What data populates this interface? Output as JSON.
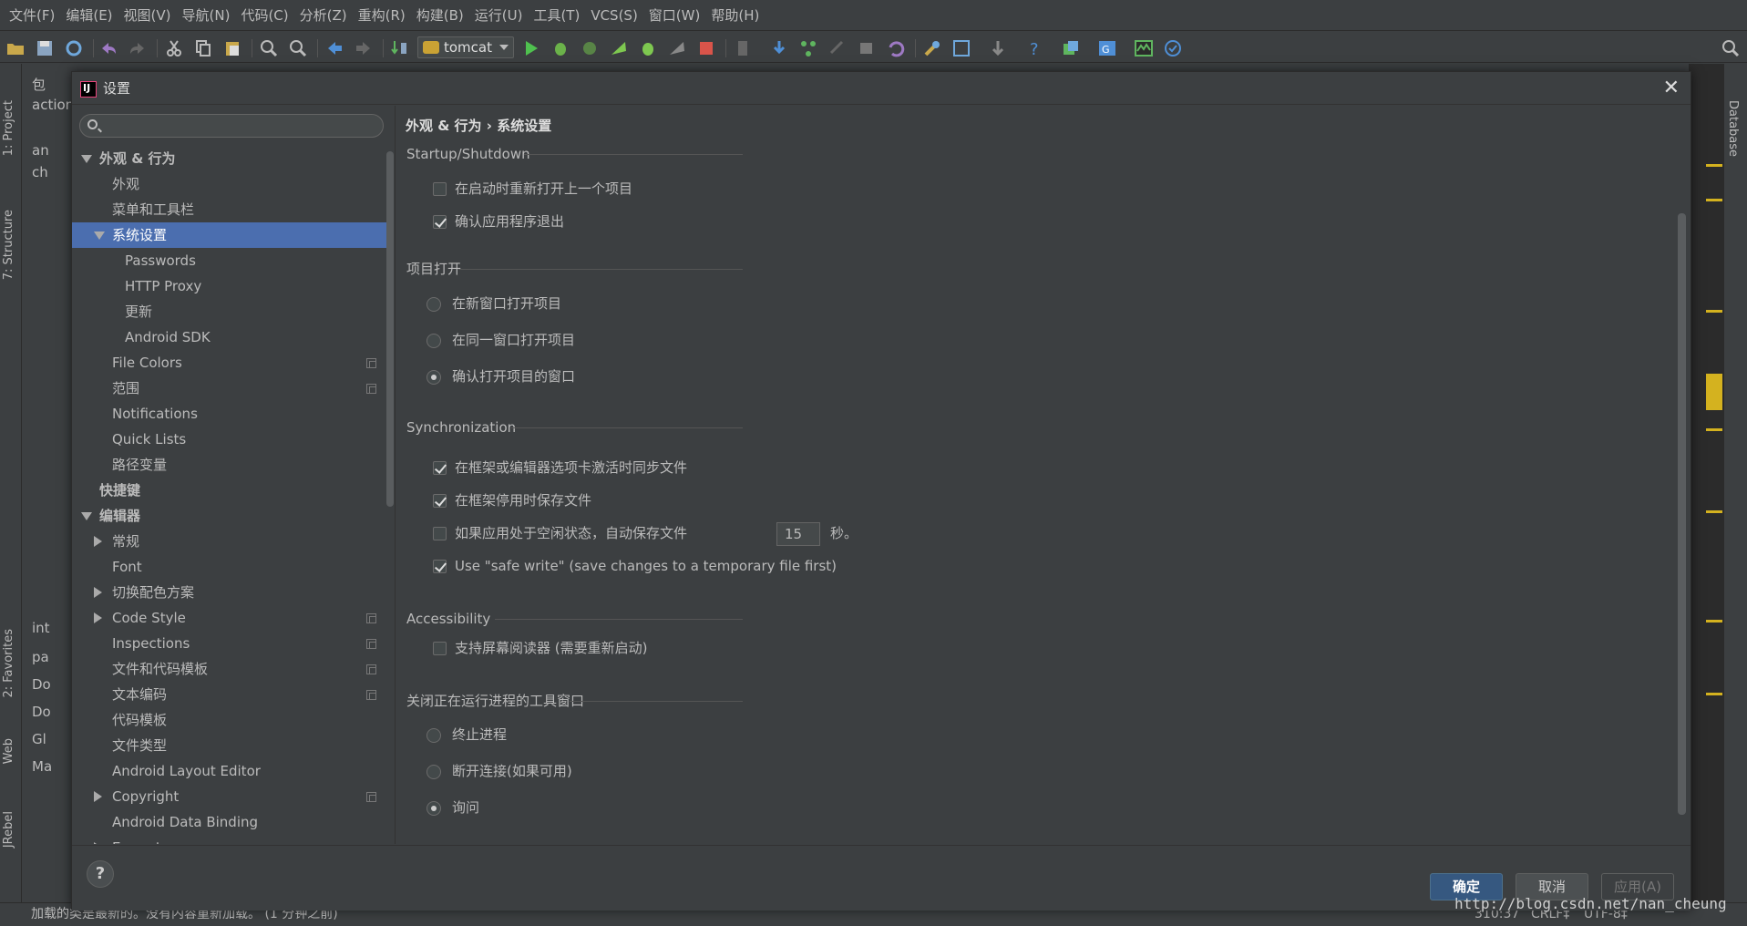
{
  "menu": [
    "文件(F)",
    "编辑(E)",
    "视图(V)",
    "导航(N)",
    "代码(C)",
    "分析(Z)",
    "重构(R)",
    "构建(B)",
    "运行(U)",
    "工具(T)",
    "VCS(S)",
    "窗口(W)",
    "帮助(H)"
  ],
  "toolbar": {
    "run_config": "tomcat"
  },
  "left_tabs": {
    "project": "1: Project",
    "structure": "7: Structure",
    "favorites": "2: Favorites",
    "web": "Web",
    "jrebel": "JRebel"
  },
  "right_tabs": {
    "database": "Database"
  },
  "project_rows": [
    "包",
    "action",
    "an",
    "ch",
    "int",
    "pa",
    "Do",
    "Do",
    "Gl",
    "Ma"
  ],
  "dialog": {
    "title": "设置",
    "close": "✕",
    "search_placeholder": "",
    "tree": [
      {
        "label": "外观 & 行为",
        "level": 0,
        "expanded": true,
        "bold": true
      },
      {
        "label": "外观",
        "level": 1
      },
      {
        "label": "菜单和工具栏",
        "level": 1
      },
      {
        "label": "系统设置",
        "level": 1,
        "expanded": true,
        "selected": true
      },
      {
        "label": "Passwords",
        "level": 2
      },
      {
        "label": "HTTP Proxy",
        "level": 2
      },
      {
        "label": "更新",
        "level": 2
      },
      {
        "label": "Android SDK",
        "level": 2
      },
      {
        "label": "File Colors",
        "level": 1,
        "copy": true
      },
      {
        "label": "范围",
        "level": 1,
        "copy": true
      },
      {
        "label": "Notifications",
        "level": 1
      },
      {
        "label": "Quick Lists",
        "level": 1
      },
      {
        "label": "路径变量",
        "level": 1
      },
      {
        "label": "快捷键",
        "level": 0,
        "bold": true
      },
      {
        "label": "编辑器",
        "level": 0,
        "expanded": true,
        "bold": true
      },
      {
        "label": "常规",
        "level": 1,
        "collapsed": true
      },
      {
        "label": "Font",
        "level": 1
      },
      {
        "label": "切换配色方案",
        "level": 1,
        "collapsed": true
      },
      {
        "label": "Code Style",
        "level": 1,
        "collapsed": true,
        "copy": true
      },
      {
        "label": "Inspections",
        "level": 1,
        "copy": true
      },
      {
        "label": "文件和代码模板",
        "level": 1,
        "copy": true
      },
      {
        "label": "文本编码",
        "level": 1,
        "copy": true
      },
      {
        "label": "代码模板",
        "level": 1
      },
      {
        "label": "文件类型",
        "level": 1
      },
      {
        "label": "Android Layout Editor",
        "level": 1
      },
      {
        "label": "Copyright",
        "level": 1,
        "collapsed": true,
        "copy": true
      },
      {
        "label": "Android Data Binding",
        "level": 1
      },
      {
        "label": "Emmet",
        "level": 1,
        "collapsed": true
      }
    ],
    "breadcrumb": {
      "parent": "外观 & 行为",
      "sep": "›",
      "current": "系统设置"
    },
    "sections": {
      "startup": {
        "title": "Startup/Shutdown",
        "reopen": "在启动时重新打开上一个项目",
        "confirm_exit": "确认应用程序退出"
      },
      "project_open": {
        "title": "项目打开",
        "new_window": "在新窗口打开项目",
        "same_window": "在同一窗口打开项目",
        "confirm": "确认打开项目的窗口"
      },
      "sync": {
        "title": "Synchronization",
        "sync_on_frame": "在框架或编辑器选项卡激活时同步文件",
        "save_on_deactivate": "在框架停用时保存文件",
        "autosave": "如果应用处于空闲状态，自动保存文件",
        "autosave_value": "15",
        "autosave_unit": "秒。",
        "safe_write": "Use \"safe write\" (save changes to a temporary file first)"
      },
      "access": {
        "title": "Accessibility",
        "screen_reader": "支持屏幕阅读器 (需要重新启动)"
      },
      "close_tool": {
        "title": "关闭正在运行进程的工具窗口",
        "terminate": "终止进程",
        "disconnect": "断开连接(如果可用)",
        "ask": "询问"
      }
    },
    "checks": {
      "reopen": false,
      "confirm_exit": true,
      "sync_on_frame": true,
      "save_on_deactivate": true,
      "autosave": false,
      "safe_write": true,
      "screen_reader": false
    },
    "radios": {
      "project_open": "confirm",
      "close_tool": "ask"
    },
    "buttons": {
      "help": "?",
      "ok": "确定",
      "cancel": "取消",
      "apply": "应用(A)"
    }
  },
  "status": {
    "message": "加载的类是最新的。没有内容重新加载。 (1 分钟之前)",
    "position": "310:37",
    "line_sep": "CRLF‡",
    "encoding": "UTF-8‡"
  },
  "watermark": "http://blog.csdn.net/nan_cheung",
  "colors": {
    "background": "#3c3f41",
    "selection": "#4b6eaf",
    "primary_button": "#365880"
  }
}
